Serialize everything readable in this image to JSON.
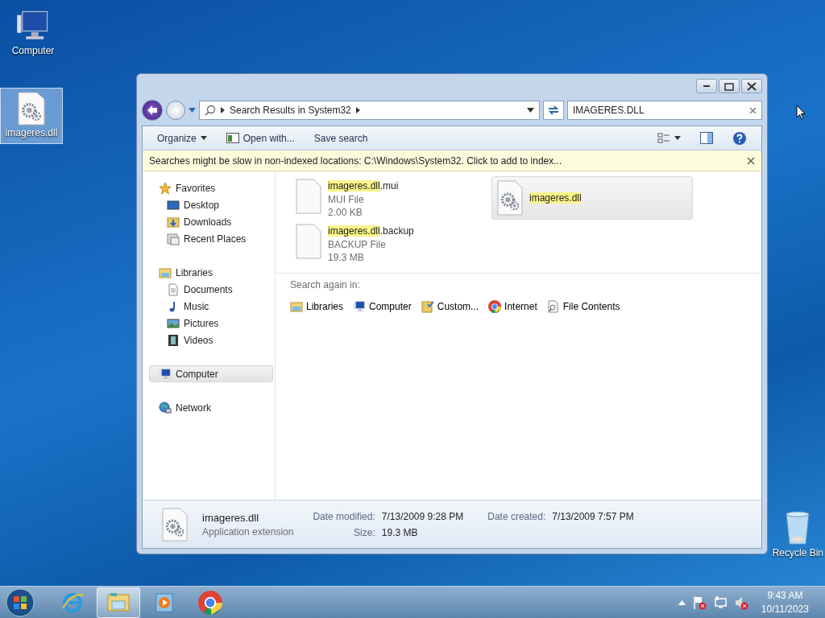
{
  "desktop_icons": [
    {
      "label": "Computer",
      "kind": "computer",
      "selected": false
    },
    {
      "label": "imageres.dll",
      "kind": "dll",
      "selected": true
    },
    {
      "label": "Recycle Bin",
      "kind": "bin",
      "selected": false
    }
  ],
  "window": {
    "address": {
      "breadcrumb": "Search Results in System32"
    },
    "search": {
      "value": "IMAGERES.DLL"
    },
    "toolbar": [
      {
        "label": "Organize",
        "kind": "menu"
      },
      {
        "label": "Open with...",
        "kind": "open"
      },
      {
        "label": "Save search",
        "kind": "plain"
      }
    ],
    "infobar": "Searches might be slow in non-indexed locations: C:\\Windows\\System32. Click to add to index...",
    "nav": [
      {
        "label": "Favorites",
        "kind": "star",
        "selected": false,
        "children": [
          {
            "label": "Desktop",
            "kind": "desktop",
            "selected": false
          },
          {
            "label": "Downloads",
            "kind": "downloads",
            "selected": false
          },
          {
            "label": "Recent Places",
            "kind": "recent",
            "selected": false
          }
        ]
      },
      {
        "label": "Libraries",
        "kind": "libraries",
        "selected": false,
        "children": [
          {
            "label": "Documents",
            "kind": "documents",
            "selected": false
          },
          {
            "label": "Music",
            "kind": "music",
            "selected": false
          },
          {
            "label": "Pictures",
            "kind": "pictures",
            "selected": false
          },
          {
            "label": "Videos",
            "kind": "videos",
            "selected": false
          }
        ]
      },
      {
        "label": "Computer",
        "kind": "computer",
        "selected": true
      },
      {
        "label": "Network",
        "kind": "network",
        "selected": false
      }
    ],
    "files": [
      {
        "match": "imageres.dll",
        "rest": ".mui",
        "type": "MUI File",
        "size": "2.00 KB",
        "kind": "blank",
        "selected": false
      },
      {
        "match": "imageres.dll",
        "kind": "dll",
        "selected": true
      },
      {
        "match": "imageres.dll",
        "rest": ".backup",
        "type": "BACKUP File",
        "size": "19.3 MB",
        "kind": "blank",
        "selected": false
      }
    ],
    "search_again": {
      "label": "Search again in:",
      "items": [
        {
          "label": "Libraries",
          "kind": "libraries"
        },
        {
          "label": "Computer",
          "kind": "computer"
        },
        {
          "label": "Custom...",
          "kind": "custom"
        },
        {
          "label": "Internet",
          "kind": "internet"
        },
        {
          "label": "File Contents",
          "kind": "contents"
        }
      ]
    },
    "details": {
      "name": "imageres.dll",
      "type": "Application extension",
      "fields": [
        {
          "label": "Date modified:",
          "value": "7/13/2009 9:28 PM"
        },
        {
          "label": "Date created:",
          "value": "7/13/2009 7:57 PM"
        },
        {
          "label": "Size:",
          "value": "19.3 MB"
        }
      ]
    }
  },
  "taskbar": {
    "items": [
      {
        "kind": "ie",
        "active": false
      },
      {
        "kind": "explorer",
        "active": true
      },
      {
        "kind": "media",
        "active": false
      },
      {
        "kind": "chrome",
        "active": false
      }
    ],
    "time": "9:43 AM",
    "date": "10/11/2023"
  }
}
